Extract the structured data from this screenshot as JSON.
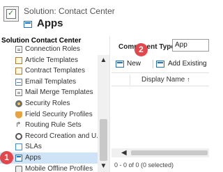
{
  "header": {
    "solution_title": "Solution: Contact Center",
    "page_title": "Apps"
  },
  "nav": {
    "title": "Solution Contact Center",
    "items": [
      {
        "label": "Connection Roles",
        "icon": "connection-roles-icon"
      },
      {
        "label": "Article Templates",
        "icon": "template-icon"
      },
      {
        "label": "Contract Templates",
        "icon": "template-icon"
      },
      {
        "label": "Email Templates",
        "icon": "email-icon"
      },
      {
        "label": "Mail Merge Templates",
        "icon": "document-icon"
      },
      {
        "label": "Security Roles",
        "icon": "security-icon"
      },
      {
        "label": "Field Security Profiles",
        "icon": "shield-icon"
      },
      {
        "label": "Routing Rule Sets",
        "icon": "routing-icon"
      },
      {
        "label": "Record Creation and U...",
        "icon": "gear-icon"
      },
      {
        "label": "SLAs",
        "icon": "sla-icon"
      },
      {
        "label": "Apps",
        "icon": "apps-icon",
        "selected": true
      },
      {
        "label": "Mobile Offline Profiles",
        "icon": "mobile-icon"
      }
    ]
  },
  "content": {
    "component_type_label": "Component Type",
    "component_type_value": "App",
    "toolbar": {
      "new_label": "New",
      "add_existing_label": "Add Existing"
    },
    "grid": {
      "column_name": "Display Name",
      "sort_indicator": "↑"
    },
    "status": "0 - 0 of 0 (0 selected)"
  },
  "markers": {
    "one": "1",
    "two": "2"
  },
  "colors": {
    "selection": "#cfe3f7",
    "marker": "#e2474b",
    "accent": "#1f6fbf"
  }
}
